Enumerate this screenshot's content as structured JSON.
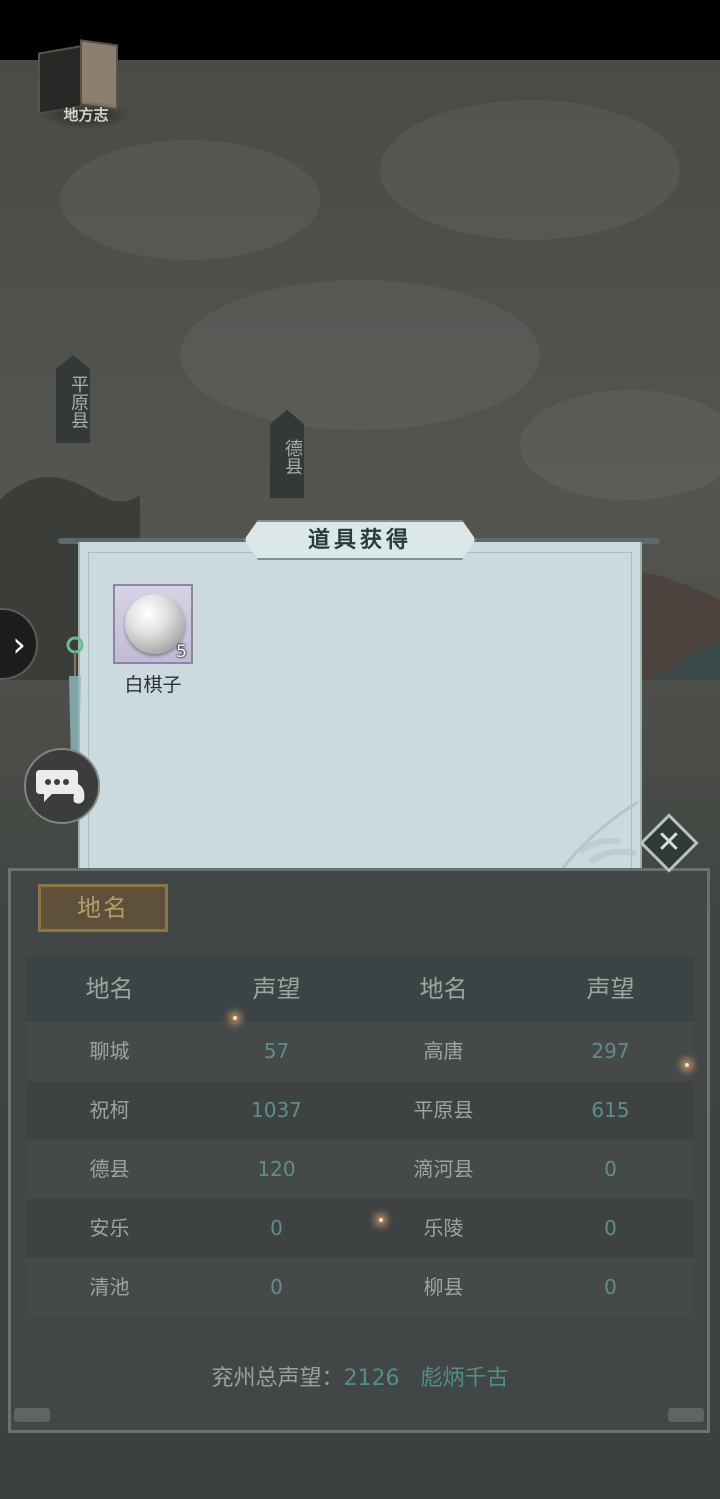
{
  "book": {
    "label": "地方志"
  },
  "map": {
    "markers": [
      "平原县",
      "德县"
    ]
  },
  "modal": {
    "title": "道具获得",
    "item": {
      "name": "白棋子",
      "quantity": "5",
      "icon": "white-go-stone-icon"
    }
  },
  "panel": {
    "tag": "地名",
    "headers": [
      "地名",
      "声望",
      "地名",
      "声望"
    ],
    "rows": [
      [
        "聊城",
        "57",
        "高唐",
        "297"
      ],
      [
        "祝柯",
        "1037",
        "平原县",
        "615"
      ],
      [
        "德县",
        "120",
        "滴河县",
        "0"
      ],
      [
        "安乐",
        "0",
        "乐陵",
        "0"
      ],
      [
        "清池",
        "0",
        "柳县",
        "0"
      ]
    ],
    "footer": {
      "label": "兖州总声望：",
      "total": "2126",
      "title": "彪炳千古"
    }
  },
  "colors": {
    "accent": "#4f8f85",
    "modal_bg": "#cbdadf",
    "tag_gold": "#8c7647"
  }
}
